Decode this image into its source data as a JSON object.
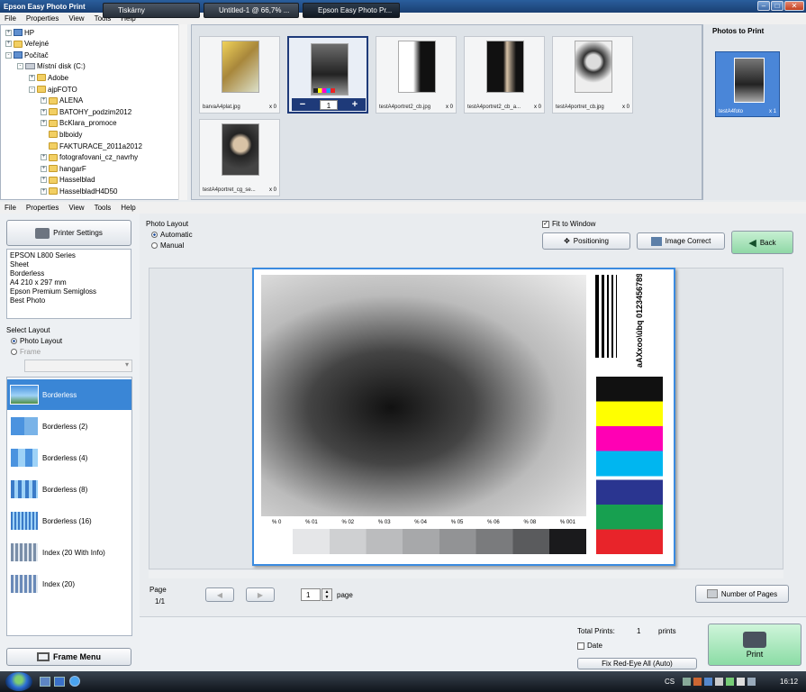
{
  "window": {
    "title": "Epson Easy Photo Print"
  },
  "menu": [
    "File",
    "Properties",
    "View",
    "Tools",
    "Help"
  ],
  "tree": [
    {
      "label": "HP",
      "level": 0,
      "icon": "pc",
      "expander": "+"
    },
    {
      "label": "Veřejné",
      "level": 0,
      "icon": "folder",
      "expander": "+"
    },
    {
      "label": "Počítač",
      "level": 0,
      "icon": "pc",
      "expander": "-"
    },
    {
      "label": "Místní disk (C:)",
      "level": 1,
      "icon": "drive",
      "expander": "-"
    },
    {
      "label": "Adobe",
      "level": 2,
      "icon": "folder",
      "expander": "+"
    },
    {
      "label": "ajpFOTO",
      "level": 2,
      "icon": "folder",
      "expander": "-"
    },
    {
      "label": "ALENA",
      "level": 3,
      "icon": "folder",
      "expander": "+"
    },
    {
      "label": "BATOHY_podzim2012",
      "level": 3,
      "icon": "folder",
      "expander": "+"
    },
    {
      "label": "BcKlara_promoce",
      "level": 3,
      "icon": "folder",
      "expander": "+"
    },
    {
      "label": "blboidy",
      "level": 3,
      "icon": "folder",
      "expander": ""
    },
    {
      "label": "FAKTURACE_2011a2012",
      "level": 3,
      "icon": "folder",
      "expander": ""
    },
    {
      "label": "fotografovani_cz_navrhy",
      "level": 3,
      "icon": "folder",
      "expander": "+"
    },
    {
      "label": "hangarF",
      "level": 3,
      "icon": "folder",
      "expander": "+"
    },
    {
      "label": "Hasselblad",
      "level": 3,
      "icon": "folder",
      "expander": "+"
    },
    {
      "label": "HasselbladH4D50",
      "level": 3,
      "icon": "folder",
      "expander": "+"
    }
  ],
  "thumbnails": [
    {
      "name": "barvaA4plat.jpg",
      "count": "x 0"
    },
    {
      "name": "",
      "count": "1",
      "selected": true
    },
    {
      "name": "testA4portret2_cb.jpg",
      "count": "x 0"
    },
    {
      "name": "testA4portret2_cb_a...",
      "count": "x 0"
    },
    {
      "name": "testA4portret_cb.jpg",
      "count": "x 0"
    },
    {
      "name": "testA4portret_cg_se...",
      "count": "x 0"
    }
  ],
  "photos_to_print": {
    "title": "Photos to Print",
    "name": "testA4foto",
    "count": "x 1"
  },
  "printer": {
    "button": "Printer Settings",
    "info": [
      "EPSON L800 Series",
      "Sheet",
      "Borderless",
      "A4 210 x 297 mm",
      "Epson Premium Semigloss",
      "Best Photo"
    ]
  },
  "select_layout": {
    "label": "Select Layout",
    "photo_layout": "Photo Layout",
    "frame": "Frame"
  },
  "layouts": [
    "Borderless",
    "Borderless (2)",
    "Borderless (4)",
    "Borderless (8)",
    "Borderless (16)",
    "Index (20 With Info)",
    "Index (20)"
  ],
  "frame_menu": "Frame Menu",
  "photo_layout": {
    "label": "Photo Layout",
    "automatic": "Automatic",
    "manual": "Manual"
  },
  "fit_to_window": "Fit to Window",
  "positioning": "Positioning",
  "image_correct": "Image Correct",
  "back": "Back",
  "gray_labels": [
    "% 0",
    "% 01",
    "% 02",
    "% 03",
    "% 04",
    "% 05",
    "% 06",
    "% 08",
    "% 001"
  ],
  "chart_text": "aAXxoo\\ûbq 0123456789 aaaaaaa",
  "page": {
    "label": "Page",
    "value": "1/1",
    "input": "1",
    "unit": "page"
  },
  "number_of_pages": "Number of Pages",
  "total_prints": {
    "label": "Total Prints:",
    "value": "1",
    "unit": "prints"
  },
  "date": "Date",
  "fix_red_eye": "Fix Red-Eye All (Auto)",
  "print": "Print",
  "taskbar": {
    "tasks": [
      "Tiskárny",
      "Untitled-1 @ 66,7% ...",
      "Epson Easy Photo Pr..."
    ],
    "lang": "CS",
    "time": "16:12"
  }
}
